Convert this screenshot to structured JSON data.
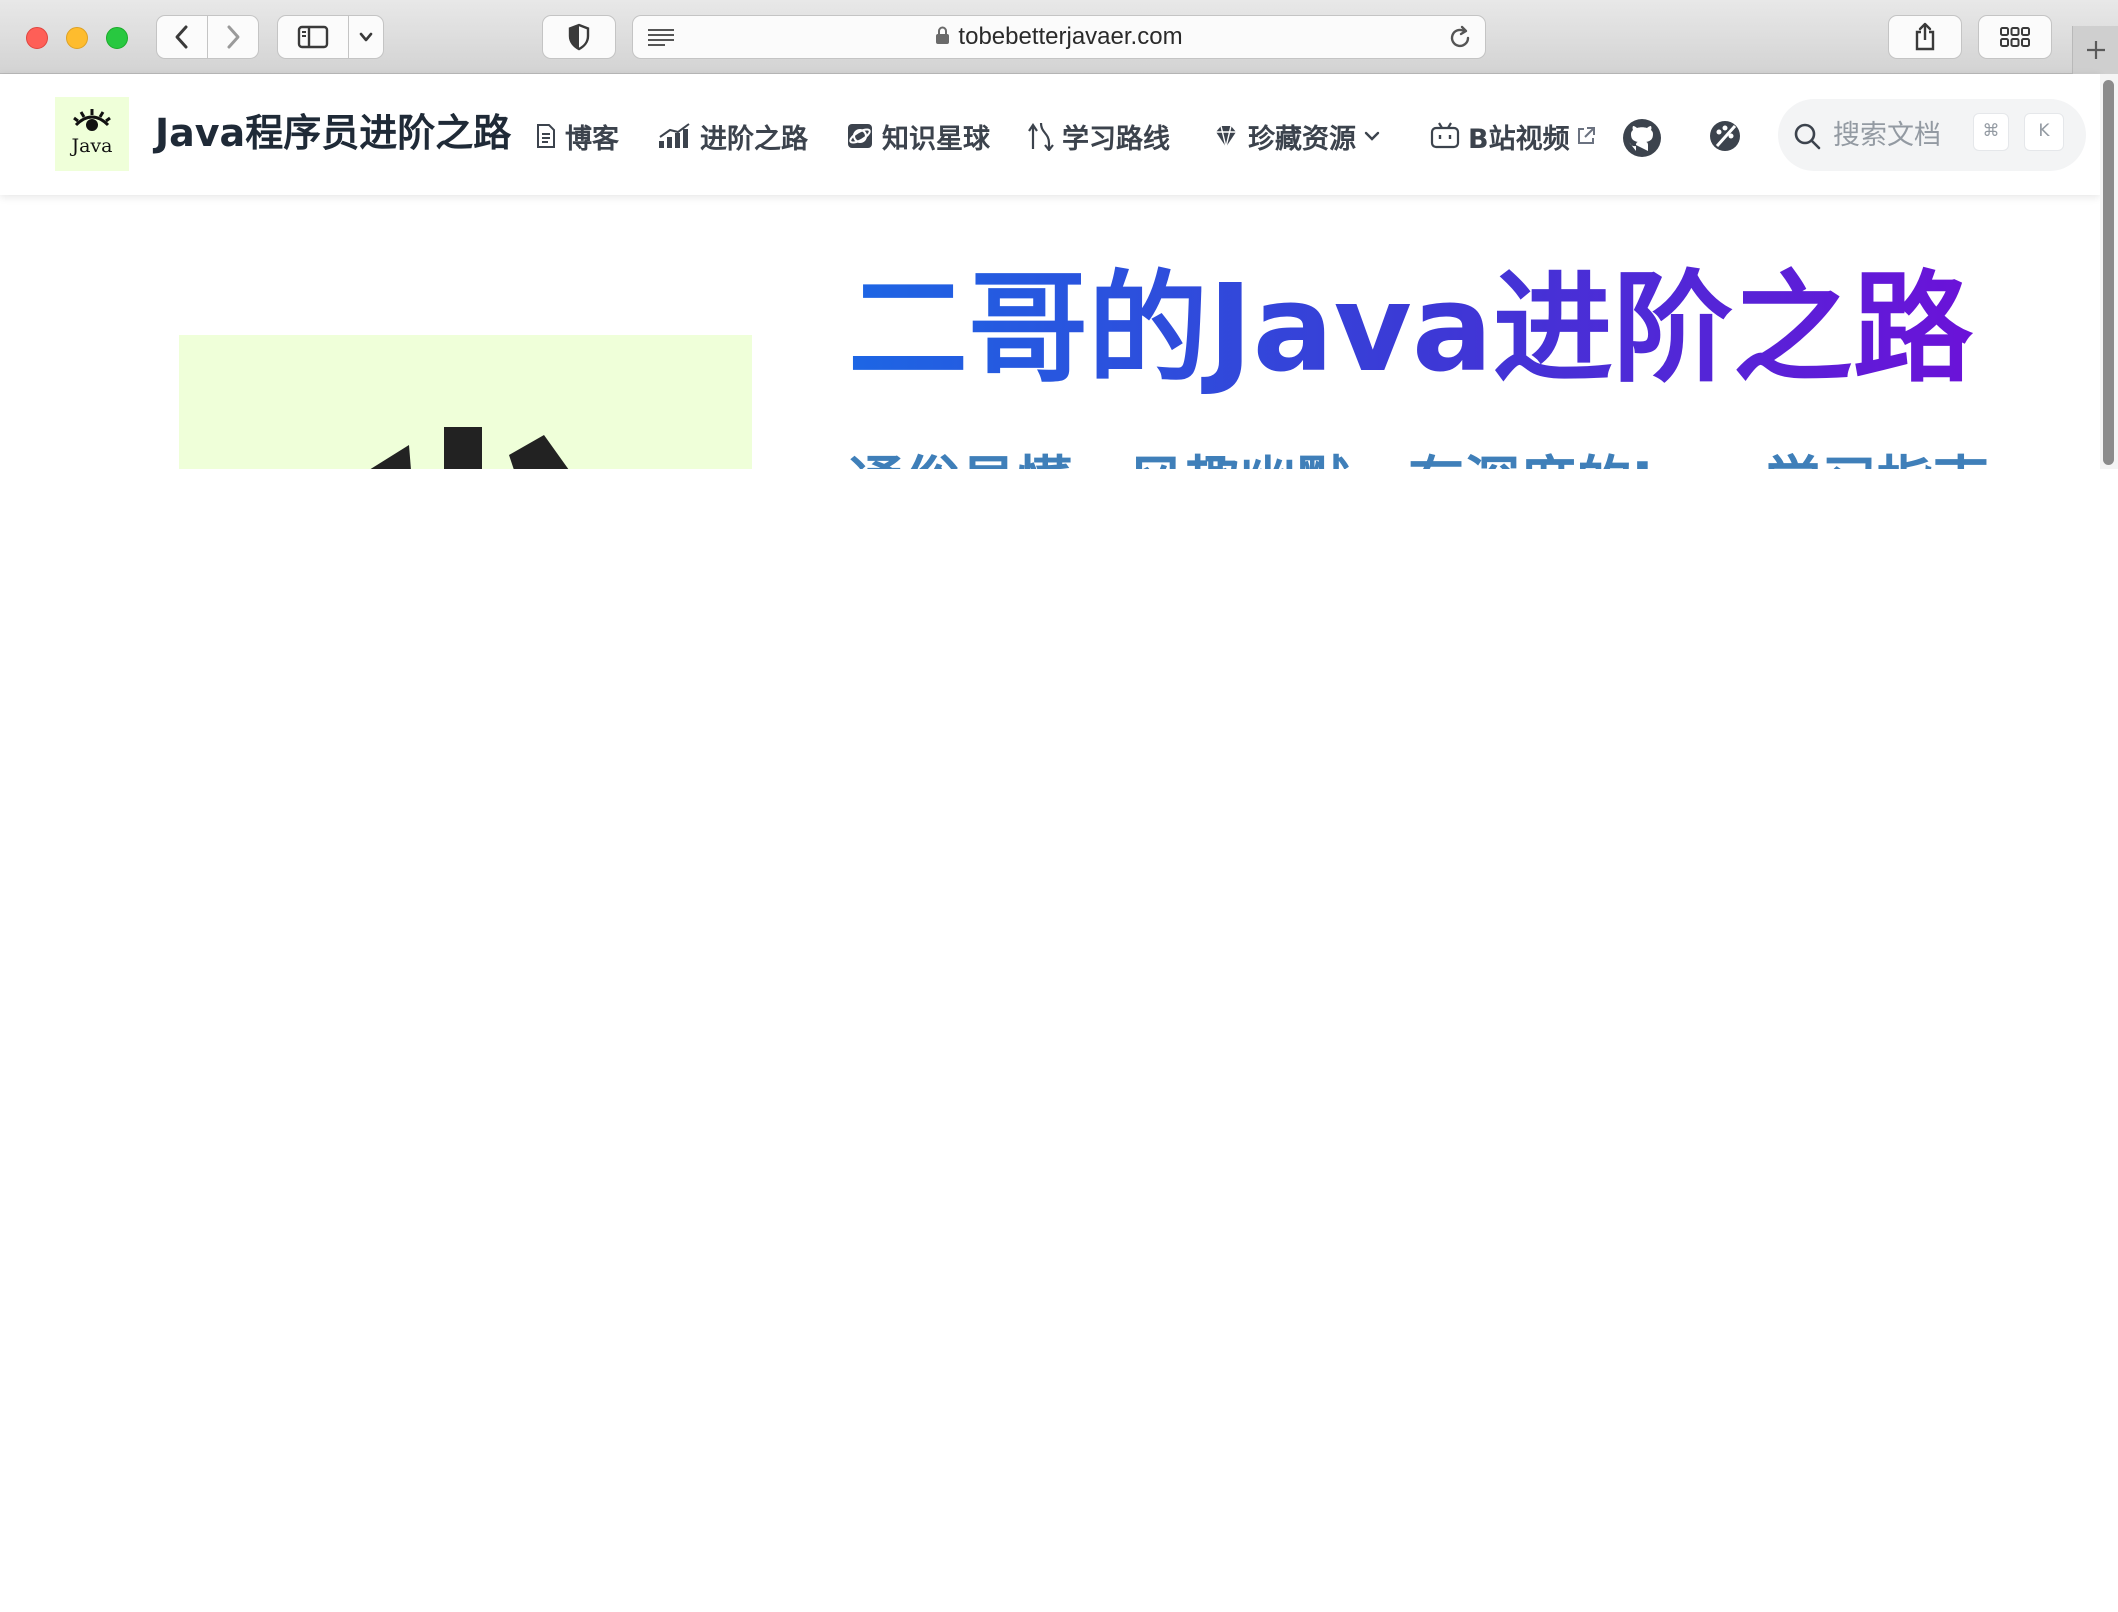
{
  "browser": {
    "url": "tobebetterjavaer.com"
  },
  "site": {
    "logo_text": "Java",
    "title": "Java程序员进阶之路"
  },
  "nav": {
    "items": [
      {
        "label": "博客",
        "icon": "document-icon"
      },
      {
        "label": "进阶之路",
        "icon": "bar-chart-icon"
      },
      {
        "label": "知识星球",
        "icon": "planet-icon"
      },
      {
        "label": "学习路线",
        "icon": "route-icon"
      },
      {
        "label": "珍藏资源",
        "icon": "gem-icon"
      },
      {
        "label": "B站视频",
        "icon": "bilibili-icon"
      }
    ],
    "github_icon": "github-icon",
    "theme_icon": "theme-toggle-icon"
  },
  "search": {
    "placeholder": "搜索文档",
    "shortcut_cmd": "⌘",
    "shortcut_key": "K"
  },
  "hero": {
    "title": "二哥的Java进阶之路",
    "subtitle": "通俗易懂、风趣幽默、有深度的Java学习指南"
  },
  "colors": {
    "hero_gradient_start": "#1d66e4",
    "hero_gradient_end": "#6b12d8",
    "logo_bg": "#efffd9"
  }
}
